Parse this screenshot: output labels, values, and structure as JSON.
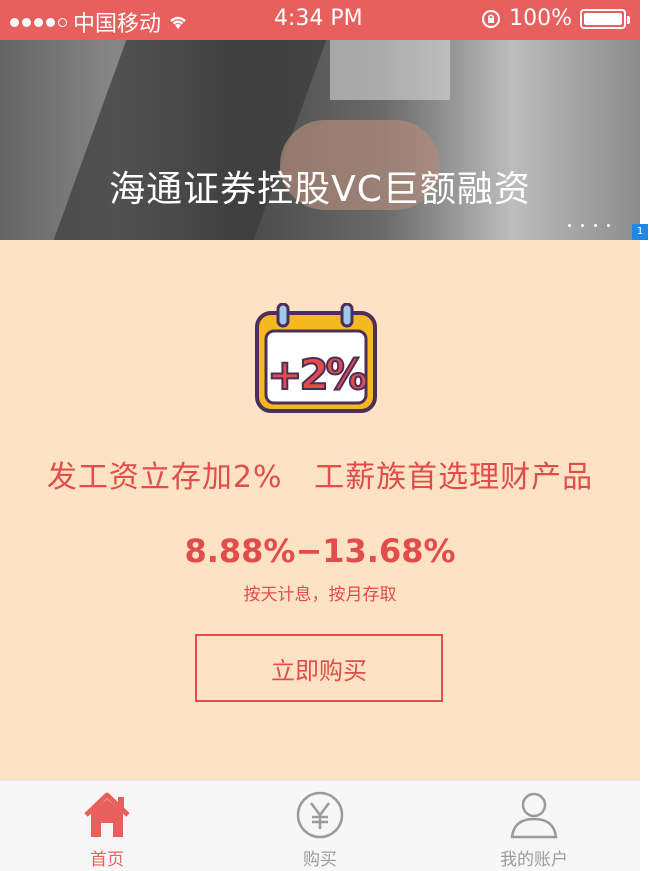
{
  "status_bar": {
    "carrier": "中国移动",
    "time": "4:34 PM",
    "battery": "100%"
  },
  "banner": {
    "title": "海通证券控股VC巨额融资",
    "page_badge": "1"
  },
  "promo": {
    "calendar_text": "+2%",
    "headline": "发工资立存加2%   工薪族首选理财产品",
    "rate": "8.88%−13.68%",
    "interest_note": "按天计息，按月存取",
    "buy_label": "立即购买"
  },
  "tabbar": {
    "items": [
      {
        "label": "首页",
        "icon": "home-icon",
        "active": true
      },
      {
        "label": "购买",
        "icon": "yen-icon",
        "active": false
      },
      {
        "label": "我的账户",
        "icon": "user-icon",
        "active": false
      }
    ]
  },
  "colors": {
    "accent": "#e24c4a",
    "status_bar": "#e8605d",
    "content_bg": "#fde3c4"
  }
}
